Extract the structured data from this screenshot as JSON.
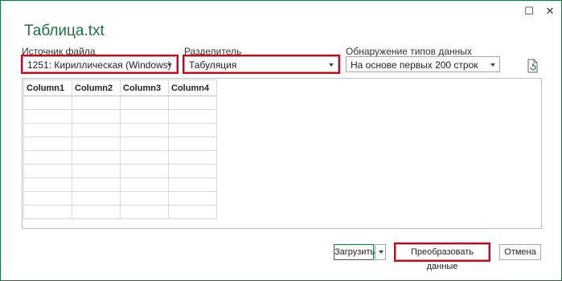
{
  "window": {
    "title": "Таблица.txt",
    "maximize_icon": "maximize-icon",
    "close_icon": "close-icon"
  },
  "source": {
    "label": "Источник файла",
    "value": "1251: Кириллическая (Windows)"
  },
  "delimiter": {
    "label": "Разделитель",
    "value": "Табуляция"
  },
  "detection": {
    "label": "Обнаружение типов данных",
    "value": "На основе первых 200 строк"
  },
  "table": {
    "columns": [
      "Column1",
      "Column2",
      "Column3",
      "Column4"
    ],
    "empty_rows": 9
  },
  "footer": {
    "load_label": "Загрузить",
    "transform_label": "Преобразовать данные",
    "cancel_label": "Отмена"
  },
  "colors": {
    "accent": "#1e7145",
    "highlight": "#d0021b"
  }
}
